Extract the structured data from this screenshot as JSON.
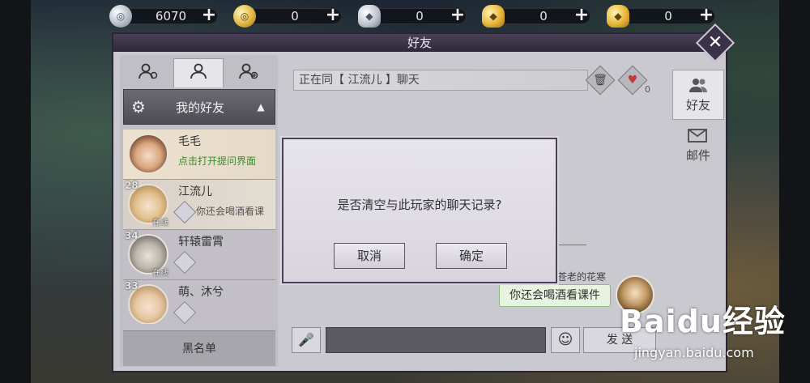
{
  "currency": [
    {
      "icon": "silver-coin-icon",
      "value": "6070",
      "plus": "+"
    },
    {
      "icon": "gold-coin-icon",
      "value": "0",
      "plus": "+"
    },
    {
      "icon": "silver-ingot-icon",
      "value": "0",
      "plus": "+"
    },
    {
      "icon": "gold-ingot-icon",
      "value": "0",
      "plus": "+"
    },
    {
      "icon": "gold-ingot-icon",
      "value": "0",
      "plus": "+"
    }
  ],
  "panel": {
    "title": "好友",
    "close": "✕"
  },
  "left": {
    "group_label": "我的好友",
    "friends": [
      {
        "level": "",
        "name": "毛毛",
        "extra": "点击打开提问界面",
        "status": ""
      },
      {
        "level": "28",
        "name": "江流儿",
        "extra": "你还会喝酒看课",
        "status": "在线"
      },
      {
        "level": "34",
        "name": "轩辕雷霄",
        "extra": "",
        "status": "在线"
      },
      {
        "level": "33",
        "name": "萌、沐兮",
        "extra": "",
        "status": ""
      }
    ],
    "blacklist": "黑名单"
  },
  "chat": {
    "title": "正在同【 江流儿 】聊天",
    "heart_count": "0",
    "sender": "苍老的花寒",
    "message": "你还会喝酒看课件",
    "send": "发 送"
  },
  "right_tabs": [
    {
      "icon": "friends-icon",
      "label": "好友"
    },
    {
      "icon": "mail-icon",
      "label": "邮件"
    }
  ],
  "dialog": {
    "message": "是否清空与此玩家的聊天记录?",
    "cancel": "取消",
    "confirm": "确定"
  },
  "watermark": {
    "logo": "Baidu经验",
    "url": "jingyan.baidu.com"
  }
}
